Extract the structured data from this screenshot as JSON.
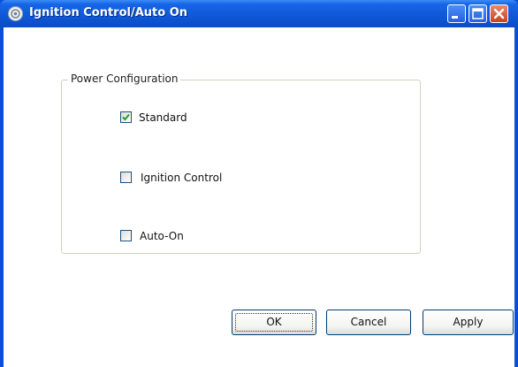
{
  "window": {
    "title": "Ignition Control/Auto On",
    "icon": "settings-gear-icon"
  },
  "titlebar_buttons": {
    "minimize": "minimize-icon",
    "maximize": "maximize-icon",
    "close": "close-icon"
  },
  "group": {
    "legend": "Power Configuration",
    "options": [
      {
        "label": "Standard",
        "checked": true
      },
      {
        "label": "Ignition Control",
        "checked": false
      },
      {
        "label": "Auto-On",
        "checked": false
      }
    ]
  },
  "buttons": {
    "ok": "OK",
    "cancel": "Cancel",
    "apply": "Apply"
  },
  "colors": {
    "titlebar": "#0f57d6",
    "close_button": "#c9421e",
    "window_background": "#ffffff"
  }
}
